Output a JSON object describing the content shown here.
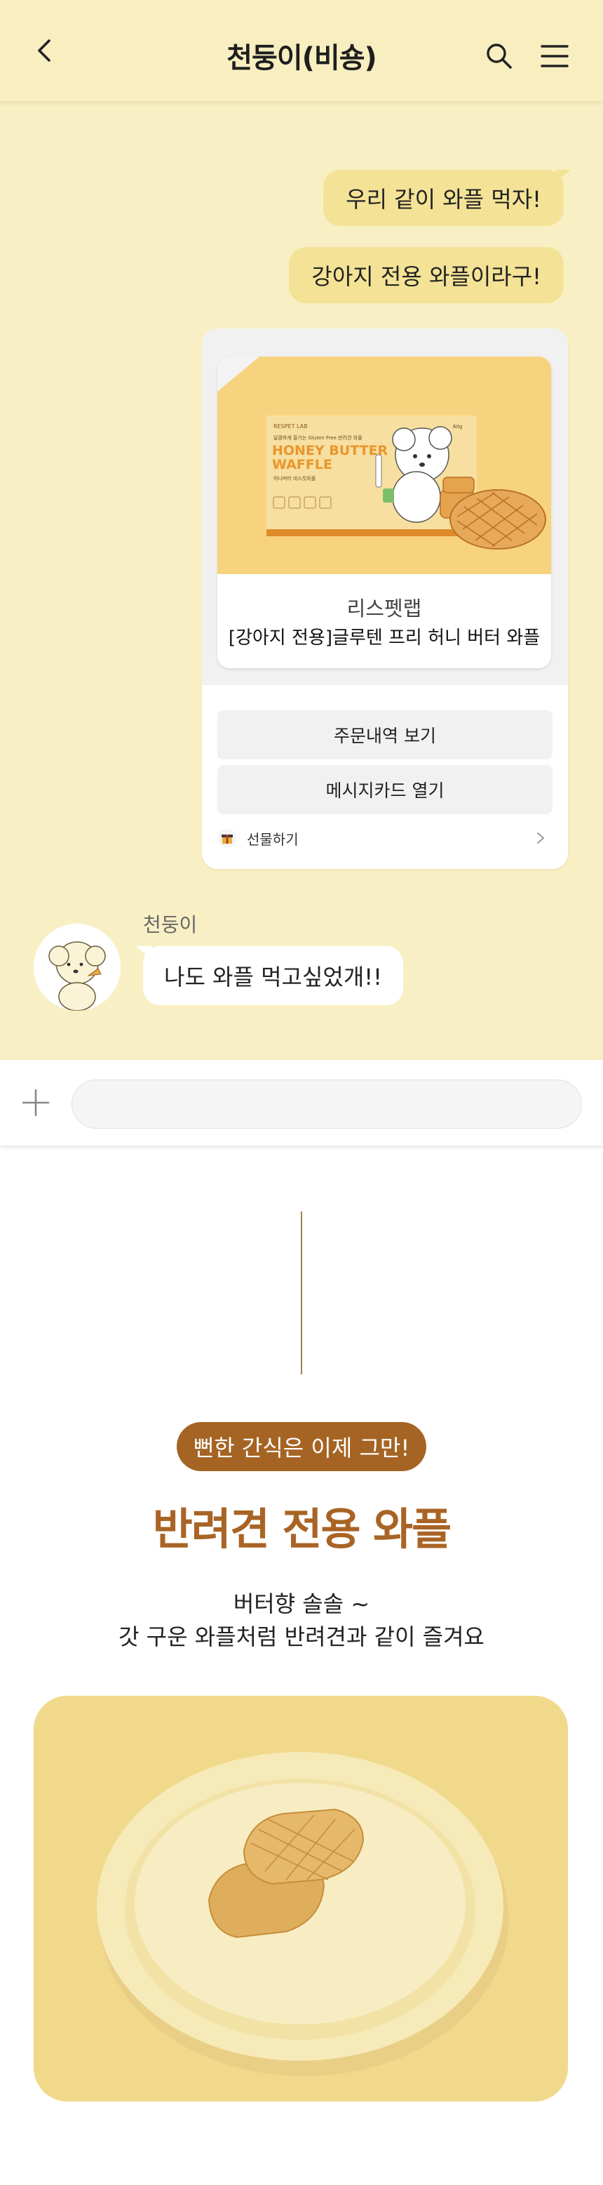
{
  "header": {
    "title": "천둥이(비숑)",
    "back_icon": "back-arrow-icon",
    "search_icon": "search-icon",
    "menu_icon": "hamburger-menu-icon"
  },
  "messages": {
    "me": [
      "우리 같이 와플 먹자!",
      "강아지 전용 와플이라구!"
    ],
    "other": {
      "sender": "천둥이",
      "text": "나도 와플 먹고싶었개!!"
    }
  },
  "gift_card": {
    "brand": "리스펫랩",
    "product_name": "[강아지 전용]글루텐 프리 허니 버터 와플",
    "package": {
      "logo": "RESPET LAB",
      "tagline": "달콤하게 즐기는 Gluten Free 반려견 와플",
      "title_line1": "HONEY BUTTER",
      "title_line2": "WAFFLE",
      "subtitle": "허니버터 비스킷와플",
      "weight": "60g"
    },
    "buttons": [
      "주문내역 보기",
      "메시지카드 열기"
    ],
    "footer_label": "선물하기"
  },
  "input": {
    "value": "",
    "placeholder": ""
  },
  "promo": {
    "badge": "뻔한 간식은 이제 그만!",
    "headline": "반려견 전용 와플",
    "sub_line1": "버터향 솔솔 ~",
    "sub_line2": "갓 구운 와플처럼 반려견과 같이 즐겨요"
  },
  "colors": {
    "chat_background": "#f8f0c4",
    "my_bubble": "#f4e396",
    "accent_brown": "#a56424",
    "headline_brown": "#a96425"
  }
}
